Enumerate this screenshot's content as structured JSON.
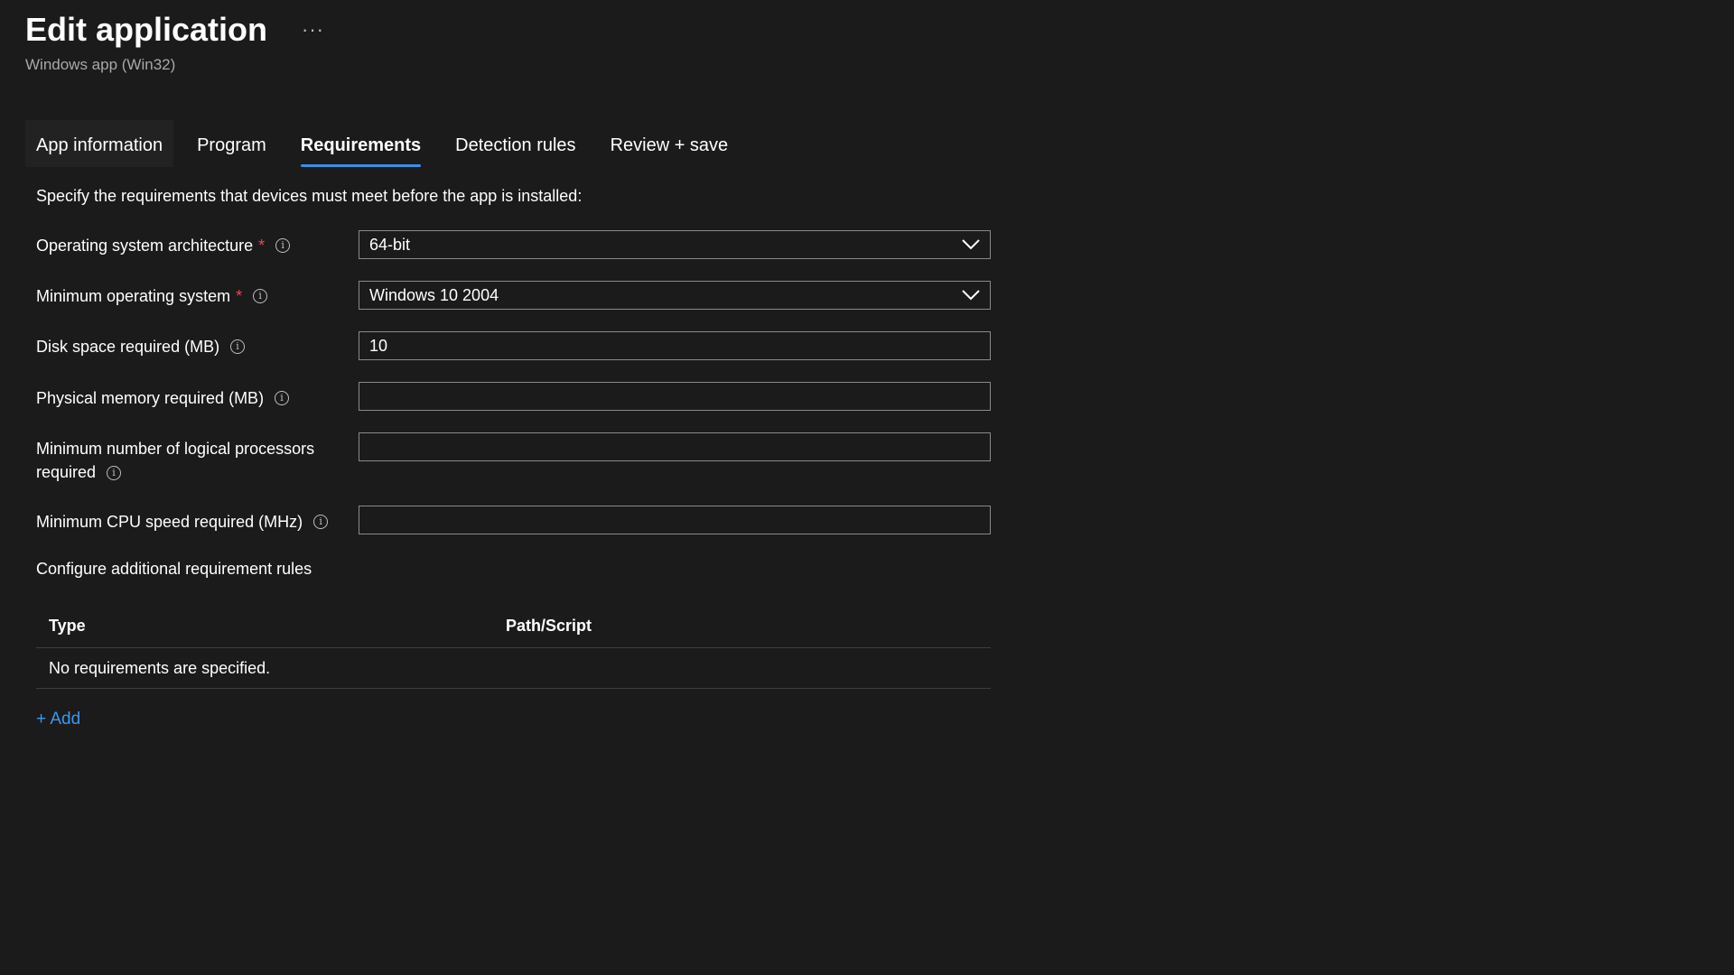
{
  "header": {
    "title": "Edit application",
    "more_label": "···",
    "subtitle": "Windows app (Win32)"
  },
  "tabs": [
    {
      "label": "App information",
      "active": false
    },
    {
      "label": "Program",
      "active": false
    },
    {
      "label": "Requirements",
      "active": true
    },
    {
      "label": "Detection rules",
      "active": false
    },
    {
      "label": "Review + save",
      "active": false
    }
  ],
  "form": {
    "intro": "Specify the requirements that devices must meet before the app is installed:",
    "os_architecture": {
      "label": "Operating system architecture",
      "required": "*",
      "value": "64-bit"
    },
    "min_os": {
      "label": "Minimum operating system",
      "required": "*",
      "value": "Windows 10 2004"
    },
    "disk_space": {
      "label": "Disk space required (MB)",
      "value": "10"
    },
    "physical_memory": {
      "label": "Physical memory required (MB)",
      "value": ""
    },
    "logical_processors": {
      "label": "Minimum number of logical processors required",
      "value": ""
    },
    "cpu_speed": {
      "label": "Minimum CPU speed required (MHz)",
      "value": ""
    }
  },
  "additional_rules": {
    "title": "Configure additional requirement rules",
    "columns": [
      "Type",
      "Path/Script"
    ],
    "empty_message": "No requirements are specified.",
    "add_label": "+ Add"
  },
  "icons": {
    "info": "info-icon",
    "dropdown": "chevron-down-icon",
    "more": "ellipsis-icon"
  },
  "colors": {
    "background": "#1b1b1b",
    "accent": "#3a8ee6",
    "link": "#3c97f0",
    "required": "#e74856"
  }
}
